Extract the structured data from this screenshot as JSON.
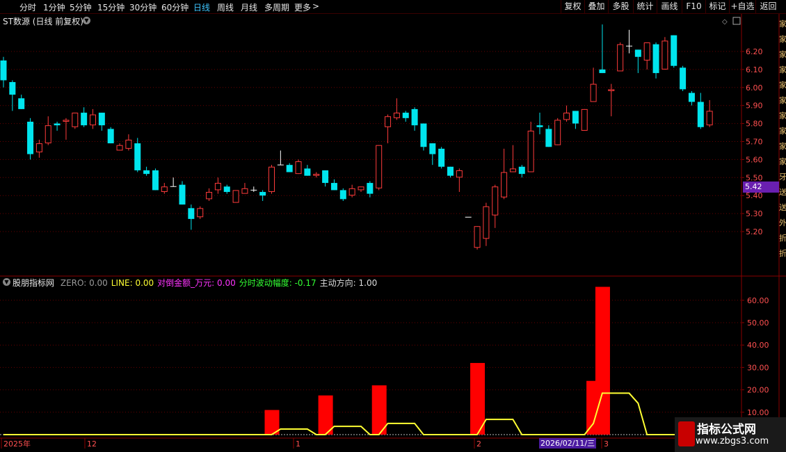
{
  "toolbar": {
    "periods": [
      "分时",
      "1分钟",
      "5分钟",
      "15分钟",
      "30分钟",
      "60分钟",
      "日线",
      "周线",
      "月线",
      "多周期",
      "更多"
    ],
    "active_period": "日线",
    "more_arrow": ">",
    "right_buttons": [
      "复权",
      "叠加",
      "多股",
      "统计",
      "画线",
      "F10",
      "标记",
      "+自选",
      "返回"
    ]
  },
  "main_chart": {
    "title": "ST数源 (日线 前复权)",
    "current_price_tag": "5.42",
    "y_axis_labels": [
      "6.20",
      "6.10",
      "6.00",
      "5.90",
      "5.80",
      "5.70",
      "5.60",
      "5.50",
      "5.40",
      "5.30",
      "5.20"
    ],
    "colors": {
      "up": "#ff3b3b",
      "down": "#00e5ee",
      "grid": "#6a0000",
      "doji": "#ffffff"
    }
  },
  "indicator": {
    "name": "股朋指标网",
    "fields": [
      {
        "label": "ZERO:",
        "value": "0.00",
        "color": "#9a9a9a"
      },
      {
        "label": "LINE:",
        "value": "0.00",
        "color": "#ffff33"
      },
      {
        "label": "对倒金额_万元:",
        "value": "0.00",
        "color": "#ff33ff"
      },
      {
        "label": "分时波动幅度:",
        "value": "-0.17",
        "color": "#33ff33"
      },
      {
        "label": "主动方向:",
        "value": "1.00",
        "color": "#dddddd"
      }
    ],
    "y_axis_labels": [
      "60.00",
      "50.00",
      "40.00",
      "30.00",
      "20.00",
      "10.00"
    ],
    "colors": {
      "bar": "#ff0000",
      "line": "#ffff33",
      "zero": "#bbbbbb"
    }
  },
  "x_axis": {
    "labels": [
      "2025年",
      "12",
      "1",
      "2",
      "3"
    ],
    "cursor_date": "2026/02/11/三"
  },
  "watermark": {
    "title": "指标公式网",
    "url": "www.zbgs3.com"
  },
  "right_strip_chars": "家家家家家家家家家家牙送送外折折"
}
